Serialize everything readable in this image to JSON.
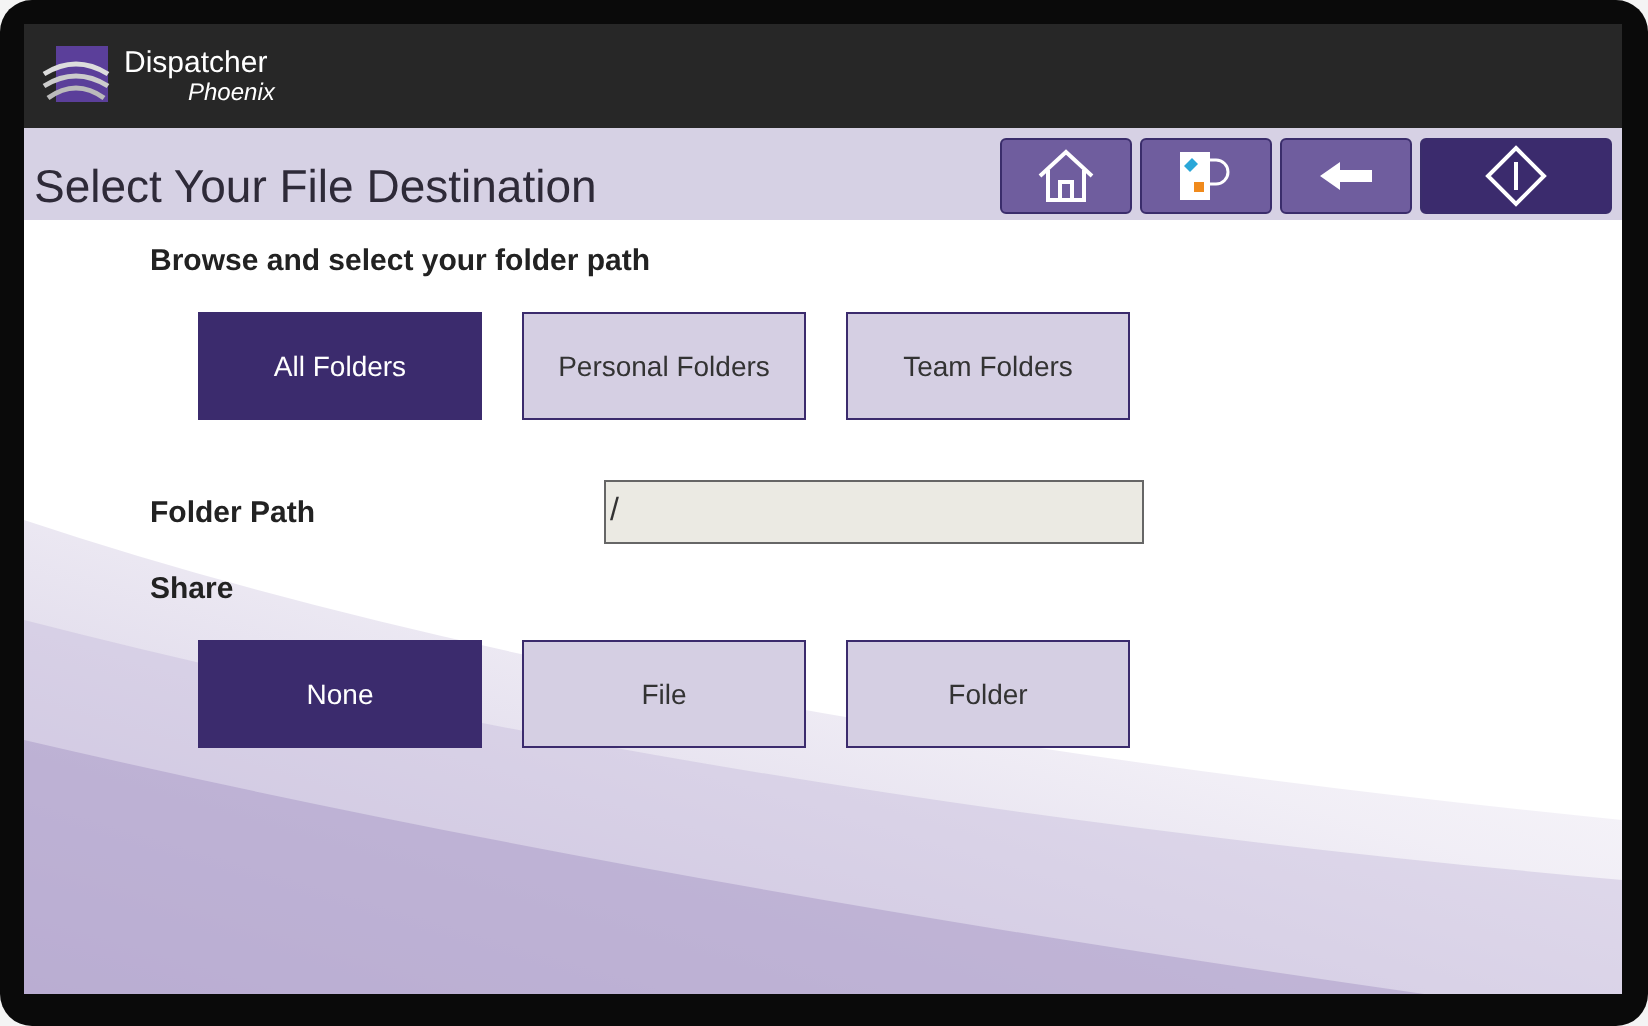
{
  "app": {
    "brand": "Dispatcher",
    "subtitle": "Phoenix"
  },
  "title": "Select Your File Destination",
  "toolbar": [
    {
      "kind": "home"
    },
    {
      "kind": "scan-return"
    },
    {
      "kind": "back"
    },
    {
      "kind": "start"
    }
  ],
  "browse": {
    "label": "Browse and select your folder path",
    "options": [
      {
        "label": "All Folders",
        "selected": true
      },
      {
        "label": "Personal Folders",
        "selected": false
      },
      {
        "label": "Team Folders",
        "selected": false
      }
    ]
  },
  "folder_path": {
    "label": "Folder Path",
    "value": "/"
  },
  "share": {
    "label": "Share",
    "options": [
      {
        "label": "None",
        "selected": true
      },
      {
        "label": "File",
        "selected": false
      },
      {
        "label": "Folder",
        "selected": false
      }
    ]
  }
}
